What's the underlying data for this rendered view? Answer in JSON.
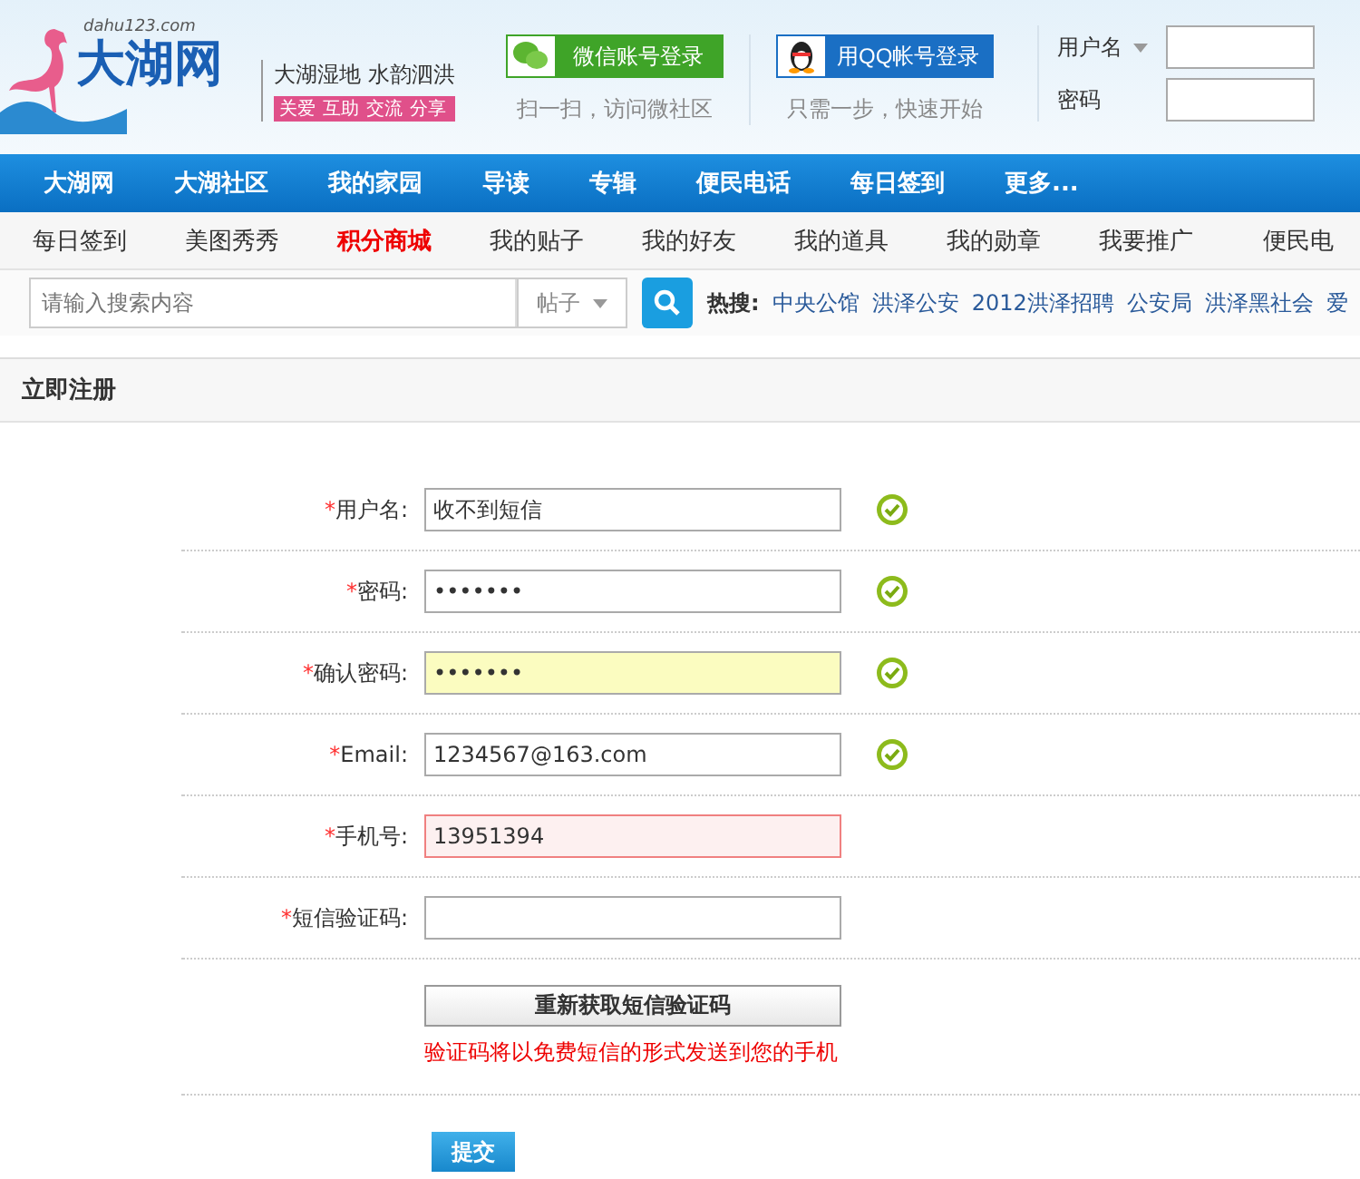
{
  "header": {
    "logo": {
      "domain": "dahu123.com",
      "name": "大湖网"
    },
    "slogan": "大湖湿地 水韵泗洪",
    "tags": [
      "关爱",
      "互助",
      "交流",
      "分享"
    ],
    "social": [
      {
        "kind": "wechat",
        "label": "微信账号登录",
        "hint": "扫一扫，访问微社区"
      },
      {
        "kind": "qq",
        "label": "用QQ帐号登录",
        "hint": "只需一步，快速开始"
      }
    ],
    "login": {
      "username_label": "用户名",
      "password_label": "密码"
    }
  },
  "nav": [
    "大湖网",
    "大湖社区",
    "我的家园",
    "导读",
    "专辑",
    "便民电话",
    "每日签到",
    "更多..."
  ],
  "subnav": [
    {
      "label": "每日签到",
      "selected": false
    },
    {
      "label": "美图秀秀",
      "selected": false
    },
    {
      "label": "积分商城",
      "selected": true
    },
    {
      "label": "我的贴子",
      "selected": false
    },
    {
      "label": "我的好友",
      "selected": false
    },
    {
      "label": "我的道具",
      "selected": false
    },
    {
      "label": "我的勋章",
      "selected": false
    },
    {
      "label": "我要推广",
      "selected": false
    },
    {
      "label": "便民电",
      "selected": false
    }
  ],
  "search": {
    "placeholder": "请输入搜索内容",
    "scope": "帖子",
    "hot_label": "热搜:",
    "hot": [
      "中央公馆",
      "洪泽公安",
      "2012洪泽招聘",
      "公安局",
      "洪泽黑社会",
      "爱"
    ]
  },
  "register": {
    "title": "立即注册",
    "fields": [
      {
        "marker": "*",
        "label": "用户名:",
        "value": "收不到短信",
        "focused": false,
        "error": false,
        "valid": true
      },
      {
        "marker": "*",
        "label": "密码:",
        "value": "•••••••",
        "focused": false,
        "error": false,
        "valid": true
      },
      {
        "marker": "*",
        "label": "确认密码:",
        "value": "•••••••",
        "focused": true,
        "error": false,
        "valid": true
      },
      {
        "marker": "*",
        "label": "Email:",
        "value": "1234567@163.com",
        "focused": false,
        "error": false,
        "valid": true
      },
      {
        "marker": "*",
        "label": "手机号:",
        "value": "13951394",
        "focused": false,
        "error": true,
        "valid": false
      },
      {
        "marker": "*",
        "label": "短信验证码:",
        "focused": false,
        "error": false,
        "valid": false
      }
    ],
    "resend_button": "重新获取短信验证码",
    "notice": "验证码将以免费短信的形式发送到您的手机",
    "submit": "提交"
  }
}
